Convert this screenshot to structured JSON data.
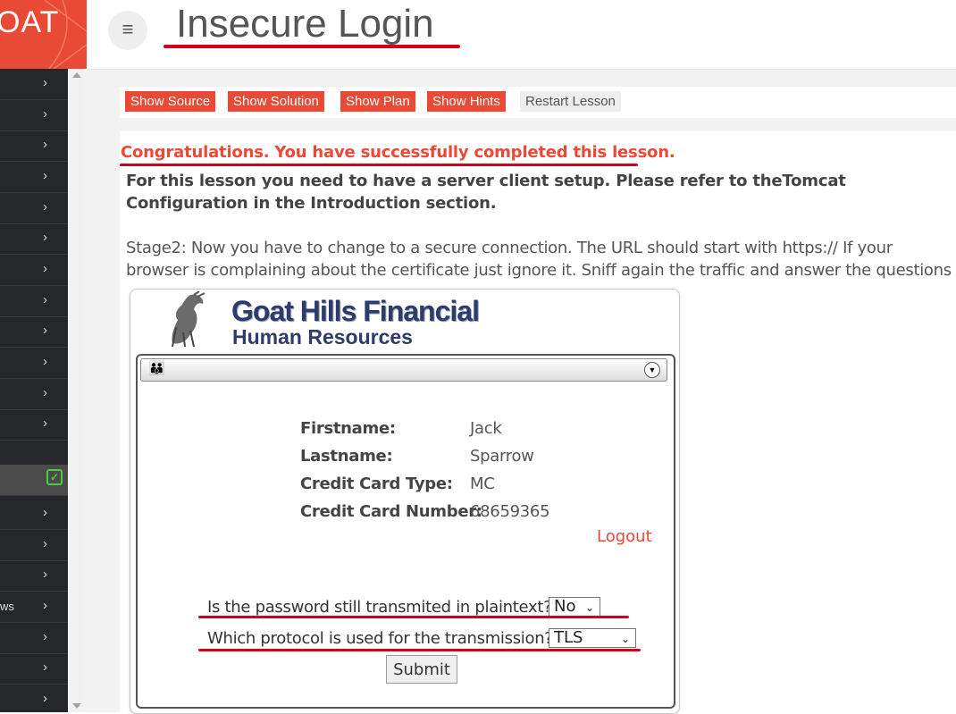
{
  "logo": {
    "text": "OAT"
  },
  "header": {
    "menu_icon": "hamburger-icon",
    "title": "Insecure Login"
  },
  "sidebar": {
    "items": [
      {
        "label": "",
        "state": "collapsed"
      },
      {
        "label": "",
        "state": "collapsed"
      },
      {
        "label": "",
        "state": "collapsed"
      },
      {
        "label": "",
        "state": "collapsed"
      },
      {
        "label": "",
        "state": "collapsed"
      },
      {
        "label": "",
        "state": "collapsed"
      },
      {
        "label": "",
        "state": "collapsed"
      },
      {
        "label": "",
        "state": "collapsed"
      },
      {
        "label": "",
        "state": "collapsed"
      },
      {
        "label": "",
        "state": "collapsed"
      },
      {
        "label": "",
        "state": "collapsed"
      },
      {
        "label": "",
        "state": "collapsed"
      },
      {
        "label": "",
        "state": "completed"
      },
      {
        "label": "",
        "state": "collapsed"
      },
      {
        "label": "",
        "state": "collapsed"
      },
      {
        "label": "",
        "state": "collapsed"
      },
      {
        "label": "ws",
        "state": "collapsed"
      },
      {
        "label": "",
        "state": "collapsed"
      },
      {
        "label": "",
        "state": "collapsed"
      },
      {
        "label": "",
        "state": "collapsed"
      }
    ]
  },
  "toolbar": {
    "show_source": "Show Source",
    "show_solution": "Show Solution",
    "show_plan": "Show Plan",
    "show_hints": "Show Hints",
    "restart_lesson": "Restart Lesson"
  },
  "lesson": {
    "congrats": "Congratulations. You have successfully completed this lesson.",
    "intro": "For this lesson you need to have a server client setup. Please refer to theTomcat Configuration in the Introduction section.",
    "stage": "Stage2: Now you have to change to a secure connection. The URL should start with https:// If your browser is complaining about the certificate just ignore it. Sniff again the traffic and answer the questions"
  },
  "app": {
    "brand_title": "Goat Hills Financial",
    "brand_subtitle": "Human Resources",
    "fields": [
      {
        "label": "Firstname:",
        "value": "Jack"
      },
      {
        "label": "Lastname:",
        "value": "Sparrow"
      },
      {
        "label": "Credit Card Type:",
        "value": "MC"
      },
      {
        "label": "Credit Card Number:",
        "value": "68659365"
      }
    ],
    "logout": "Logout",
    "question1": "Is the password still transmited in plaintext?",
    "answer1": "No",
    "question2": "Which protocol is used for the transmission?",
    "answer2": "TLS",
    "submit": "Submit"
  },
  "colors": {
    "accent": "#e94a36",
    "sidebar": "#26272b",
    "annotation": "#d0021b",
    "success": "#4ccd3f"
  }
}
